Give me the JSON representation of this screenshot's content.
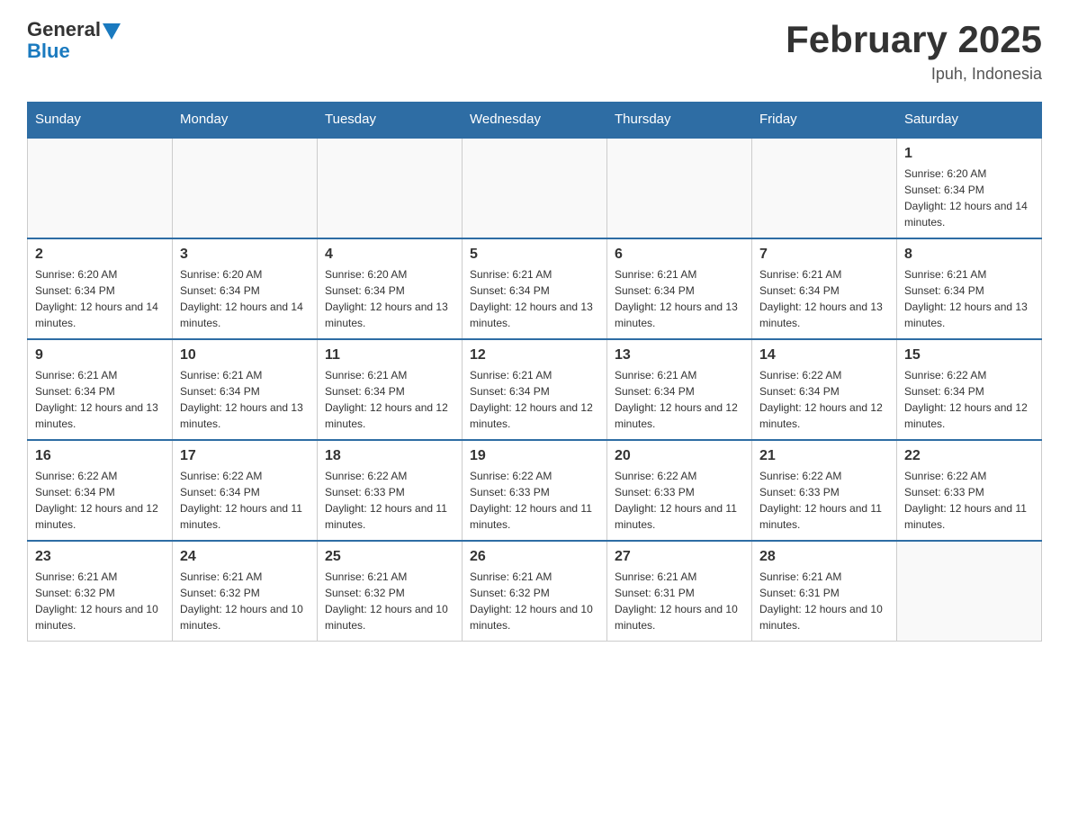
{
  "header": {
    "logo_general": "General",
    "logo_blue": "Blue",
    "month_title": "February 2025",
    "location": "Ipuh, Indonesia"
  },
  "weekdays": [
    "Sunday",
    "Monday",
    "Tuesday",
    "Wednesday",
    "Thursday",
    "Friday",
    "Saturday"
  ],
  "weeks": [
    [
      {
        "day": "",
        "info": ""
      },
      {
        "day": "",
        "info": ""
      },
      {
        "day": "",
        "info": ""
      },
      {
        "day": "",
        "info": ""
      },
      {
        "day": "",
        "info": ""
      },
      {
        "day": "",
        "info": ""
      },
      {
        "day": "1",
        "info": "Sunrise: 6:20 AM\nSunset: 6:34 PM\nDaylight: 12 hours and 14 minutes."
      }
    ],
    [
      {
        "day": "2",
        "info": "Sunrise: 6:20 AM\nSunset: 6:34 PM\nDaylight: 12 hours and 14 minutes."
      },
      {
        "day": "3",
        "info": "Sunrise: 6:20 AM\nSunset: 6:34 PM\nDaylight: 12 hours and 14 minutes."
      },
      {
        "day": "4",
        "info": "Sunrise: 6:20 AM\nSunset: 6:34 PM\nDaylight: 12 hours and 13 minutes."
      },
      {
        "day": "5",
        "info": "Sunrise: 6:21 AM\nSunset: 6:34 PM\nDaylight: 12 hours and 13 minutes."
      },
      {
        "day": "6",
        "info": "Sunrise: 6:21 AM\nSunset: 6:34 PM\nDaylight: 12 hours and 13 minutes."
      },
      {
        "day": "7",
        "info": "Sunrise: 6:21 AM\nSunset: 6:34 PM\nDaylight: 12 hours and 13 minutes."
      },
      {
        "day": "8",
        "info": "Sunrise: 6:21 AM\nSunset: 6:34 PM\nDaylight: 12 hours and 13 minutes."
      }
    ],
    [
      {
        "day": "9",
        "info": "Sunrise: 6:21 AM\nSunset: 6:34 PM\nDaylight: 12 hours and 13 minutes."
      },
      {
        "day": "10",
        "info": "Sunrise: 6:21 AM\nSunset: 6:34 PM\nDaylight: 12 hours and 13 minutes."
      },
      {
        "day": "11",
        "info": "Sunrise: 6:21 AM\nSunset: 6:34 PM\nDaylight: 12 hours and 12 minutes."
      },
      {
        "day": "12",
        "info": "Sunrise: 6:21 AM\nSunset: 6:34 PM\nDaylight: 12 hours and 12 minutes."
      },
      {
        "day": "13",
        "info": "Sunrise: 6:21 AM\nSunset: 6:34 PM\nDaylight: 12 hours and 12 minutes."
      },
      {
        "day": "14",
        "info": "Sunrise: 6:22 AM\nSunset: 6:34 PM\nDaylight: 12 hours and 12 minutes."
      },
      {
        "day": "15",
        "info": "Sunrise: 6:22 AM\nSunset: 6:34 PM\nDaylight: 12 hours and 12 minutes."
      }
    ],
    [
      {
        "day": "16",
        "info": "Sunrise: 6:22 AM\nSunset: 6:34 PM\nDaylight: 12 hours and 12 minutes."
      },
      {
        "day": "17",
        "info": "Sunrise: 6:22 AM\nSunset: 6:34 PM\nDaylight: 12 hours and 11 minutes."
      },
      {
        "day": "18",
        "info": "Sunrise: 6:22 AM\nSunset: 6:33 PM\nDaylight: 12 hours and 11 minutes."
      },
      {
        "day": "19",
        "info": "Sunrise: 6:22 AM\nSunset: 6:33 PM\nDaylight: 12 hours and 11 minutes."
      },
      {
        "day": "20",
        "info": "Sunrise: 6:22 AM\nSunset: 6:33 PM\nDaylight: 12 hours and 11 minutes."
      },
      {
        "day": "21",
        "info": "Sunrise: 6:22 AM\nSunset: 6:33 PM\nDaylight: 12 hours and 11 minutes."
      },
      {
        "day": "22",
        "info": "Sunrise: 6:22 AM\nSunset: 6:33 PM\nDaylight: 12 hours and 11 minutes."
      }
    ],
    [
      {
        "day": "23",
        "info": "Sunrise: 6:21 AM\nSunset: 6:32 PM\nDaylight: 12 hours and 10 minutes."
      },
      {
        "day": "24",
        "info": "Sunrise: 6:21 AM\nSunset: 6:32 PM\nDaylight: 12 hours and 10 minutes."
      },
      {
        "day": "25",
        "info": "Sunrise: 6:21 AM\nSunset: 6:32 PM\nDaylight: 12 hours and 10 minutes."
      },
      {
        "day": "26",
        "info": "Sunrise: 6:21 AM\nSunset: 6:32 PM\nDaylight: 12 hours and 10 minutes."
      },
      {
        "day": "27",
        "info": "Sunrise: 6:21 AM\nSunset: 6:31 PM\nDaylight: 12 hours and 10 minutes."
      },
      {
        "day": "28",
        "info": "Sunrise: 6:21 AM\nSunset: 6:31 PM\nDaylight: 12 hours and 10 minutes."
      },
      {
        "day": "",
        "info": ""
      }
    ]
  ]
}
